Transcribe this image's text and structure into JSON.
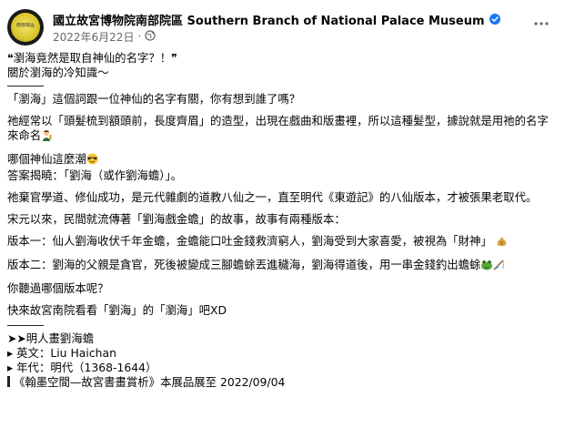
{
  "header": {
    "page_name": "國立故宮博物院南部院區 Southern Branch of National Palace Museum",
    "date": "2022年6月22日",
    "dot": "·",
    "avatar_text": "南部院區"
  },
  "post": {
    "line1": "❝瀏海竟然是取自神仙的名字？！❞",
    "line2": "關於瀏海的冷知識～",
    "p1": "「瀏海」這個詞跟一位神仙的名字有關，你有想到誰了嗎？",
    "p2": "祂經常以「頭髮梳到額頭前，長度齊眉」的造型，出現在戲曲和版畫裡，所以這種髮型，據說就是用祂的名字來命名",
    "p3a": "哪個神仙這麼潮",
    "p3b": "答案揭曉：「劉海（或作劉海蟾）」。",
    "p4": "祂棄官學道、修仙成功，是元代雜劇的道教八仙之一，直至明代《東遊記》的八仙版本，才被張果老取代。",
    "p5": "宋元以來，民間就流傳著「劉海戲金蟾」的故事，故事有兩種版本：",
    "p6": "版本一：仙人劉海收伏千年金蟾，金蟾能口吐金錢救濟窮人，劉海受到大家喜愛，被視為「財神」",
    "p7": "版本二：劉海的父親是貪官，死後被變成三腳蟾蜍丟進穢海，劉海得道後，用一串金錢釣出蟾蜍",
    "p8": "你聽過哪個版本呢？",
    "p9": "快來故宮南院看看「劉海」的「瀏海」吧XD",
    "item_title": "➤➤明人畫劉海蟾",
    "item_en_label": "▸ 英文：Liu Haichan",
    "item_era": "▸ 年代：明代（1368-1644）",
    "exhibit": "《翰墨空間—故宮書畫賞析》本展品展至 2022/09/04"
  },
  "colors": {
    "verified": "#1877f2",
    "meta": "#65676b",
    "text": "#050505"
  },
  "icons": [
    "verified-badge-icon",
    "globe-icon",
    "more-options-icon",
    "person-emoji-icon",
    "cool-face-emoji-icon",
    "money-bag-emoji-icon",
    "frog-emoji-icon",
    "fishing-pole-emoji-icon"
  ]
}
